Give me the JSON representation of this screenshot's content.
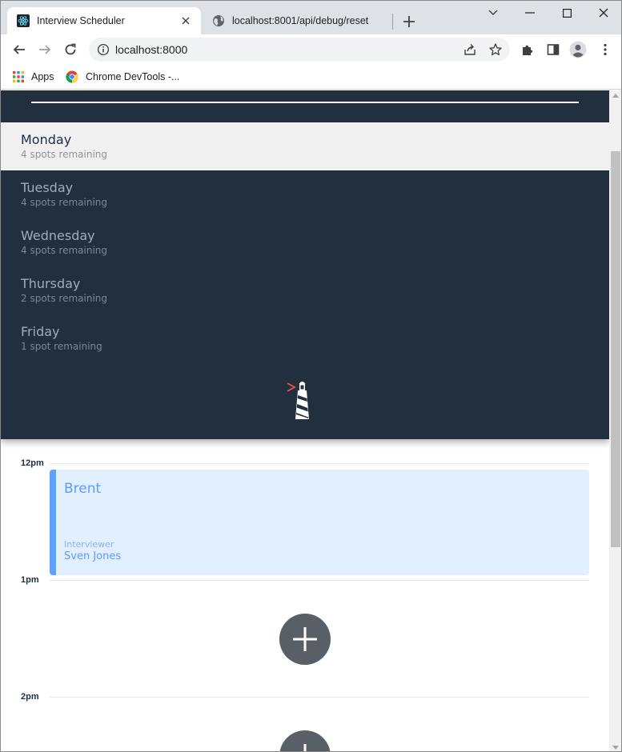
{
  "browser": {
    "active_tab": {
      "title": "Interview Scheduler"
    },
    "inactive_tab": {
      "title": "localhost:8001/api/debug/reset"
    },
    "url": "localhost:8000",
    "bookmarks": [
      {
        "label": "Apps"
      },
      {
        "label": "Chrome DevTools -..."
      }
    ]
  },
  "sidebar": {
    "days": [
      {
        "name": "Monday",
        "spots": "4 spots remaining",
        "selected": true
      },
      {
        "name": "Tuesday",
        "spots": "4 spots remaining",
        "selected": false
      },
      {
        "name": "Wednesday",
        "spots": "4 spots remaining",
        "selected": false
      },
      {
        "name": "Thursday",
        "spots": "2 spots remaining",
        "selected": false
      },
      {
        "name": "Friday",
        "spots": "1 spot remaining",
        "selected": false
      }
    ],
    "logo_icon": "lighthouse-icon"
  },
  "schedule": {
    "times": [
      "12pm",
      "1pm",
      "2pm"
    ],
    "appointment": {
      "student": "Brent",
      "interviewer_label": "Interviewer",
      "interviewer_name": "Sven Jones"
    },
    "add_icon": "plus-icon"
  },
  "colors": {
    "sidebar_bg": "#222f3e",
    "selected_day_bg": "#f0f0f0",
    "appointment_bg": "#e2efff",
    "appointment_accent": "#5da0ff",
    "add_button_bg": "#585f67"
  }
}
